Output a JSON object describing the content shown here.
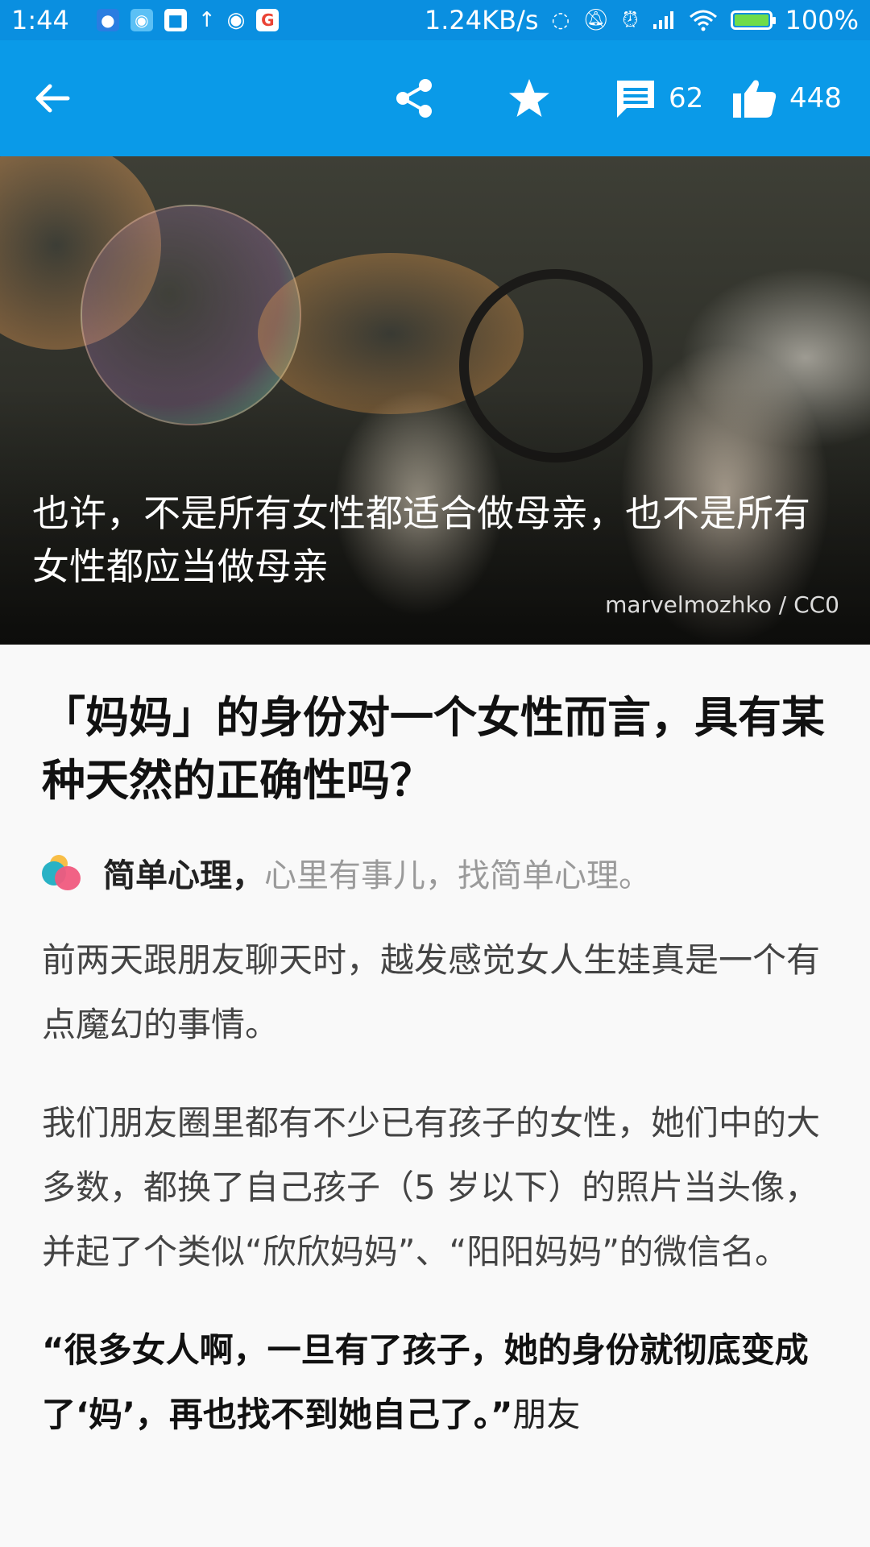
{
  "statusbar": {
    "time": "1:44",
    "network_speed": "1.24KB/s",
    "battery_percent": "100%",
    "battery_level": 1.0,
    "notification_icons": [
      "chat-icon",
      "photo-icon",
      "upload-icon",
      "camera-icon",
      "google-icon"
    ]
  },
  "toolbar": {
    "comment_count": "62",
    "like_count": "448"
  },
  "hero": {
    "caption": "也许，不是所有女性都适合做母亲，也不是所有女性都应当做母亲",
    "credit": "marvelmozhko / CC0"
  },
  "article": {
    "title": "「妈妈」的身份对一个女性而言，具有某种天然的正确性吗？",
    "author_name": "简单心理，",
    "author_tagline": "心里有事儿，找简单心理。",
    "paragraphs": [
      "前两天跟朋友聊天时，越发感觉女人生娃真是一个有点魔幻的事情。",
      "我们朋友圈里都有不少已有孩子的女性，她们中的大多数，都换了自己孩子（5 岁以下）的照片当头像，并起了个类似“欣欣妈妈”、“阳阳妈妈”的微信名。"
    ],
    "quote_bold": "“很多女人啊，一旦有了孩子，她的身份就彻底变成了‘妈’，再也找不到她自己了。”",
    "quote_tail": "朋友"
  },
  "colors": {
    "statusbar": "#0a8fe0",
    "toolbar": "#0a9ae8",
    "background": "#f9f9f9"
  }
}
